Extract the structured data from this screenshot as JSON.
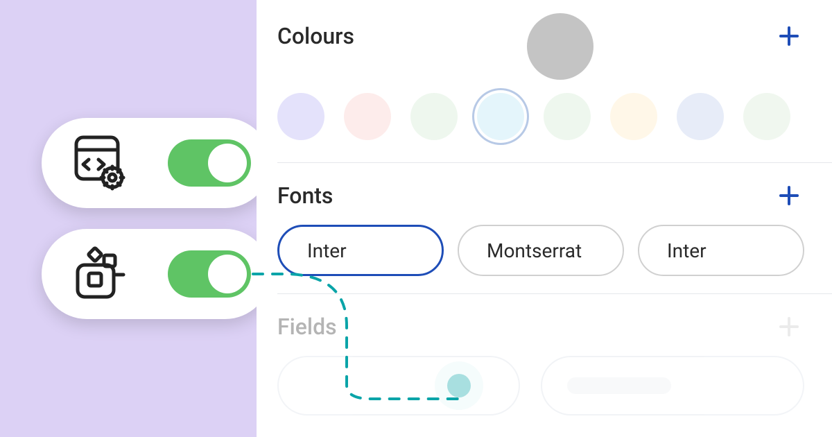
{
  "sections": {
    "colours": {
      "title": "Colours"
    },
    "fonts": {
      "title": "Fonts"
    },
    "fields": {
      "title": "Fields"
    }
  },
  "fonts": {
    "options": [
      {
        "label": "Inter",
        "selected": true
      },
      {
        "label": "Montserrat",
        "selected": false
      },
      {
        "label": "Inter",
        "selected": false
      }
    ]
  },
  "colours": {
    "swatches": [
      {
        "hex": "#e4e2fb",
        "selected": false
      },
      {
        "hex": "#fdeceb",
        "selected": false
      },
      {
        "hex": "#eef7ee",
        "selected": false
      },
      {
        "hex": "#e4f5fb",
        "selected": true
      },
      {
        "hex": "#eef7ee",
        "selected": false
      },
      {
        "hex": "#fff7e8",
        "selected": false
      },
      {
        "hex": "#e7ecf8",
        "selected": false
      },
      {
        "hex": "#f0f7ef",
        "selected": false
      }
    ],
    "active_hex": "#c4c4c4"
  },
  "toggles": {
    "code_settings": true,
    "components": true
  },
  "accent": "#1e4db7",
  "toggle_on_color": "#5fc465",
  "cursor_color": "#0aa4a8"
}
